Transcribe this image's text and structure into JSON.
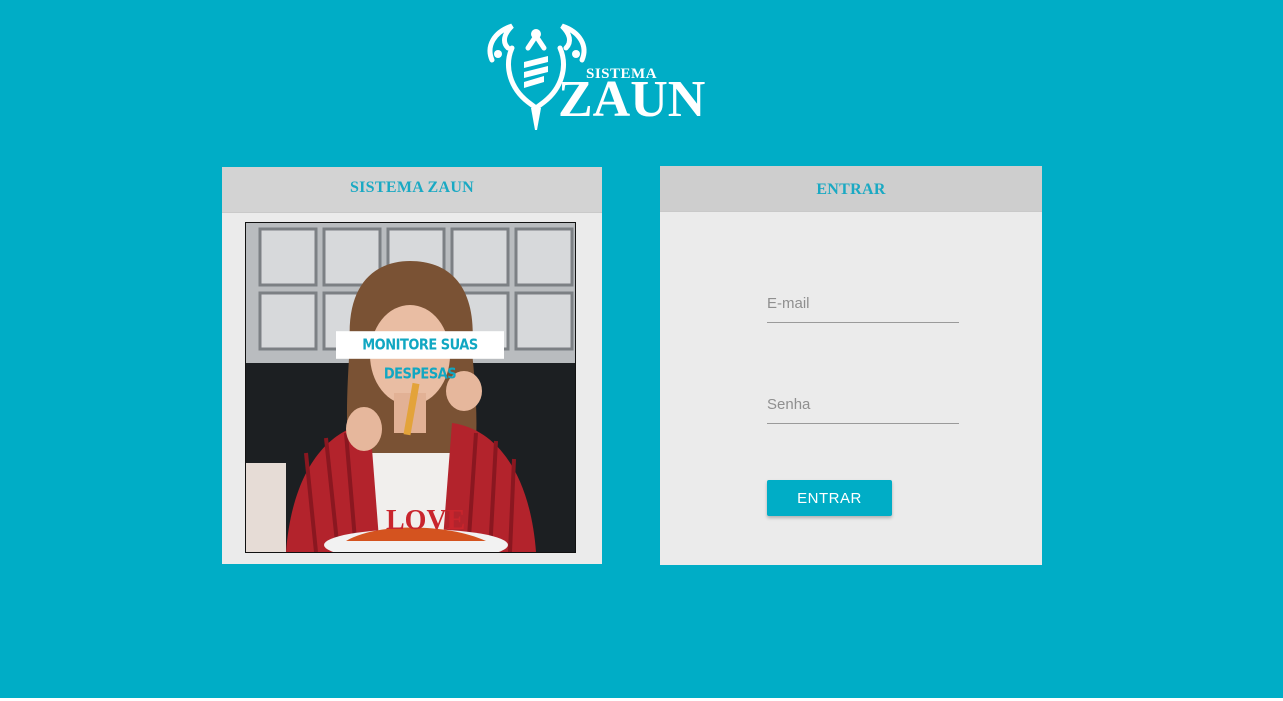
{
  "logo": {
    "small_text": "SISTEMA",
    "big_text": "ZAUN",
    "icon": "zaun-emblem-icon"
  },
  "left_panel": {
    "title": "SISTEMA ZAUN",
    "image_caption": "MONITORE SUAS DESPESAS",
    "image_icon": "photo-woman-eating-fries"
  },
  "right_panel": {
    "title": "ENTRAR",
    "email_placeholder": "E-mail",
    "email_value": "",
    "password_placeholder": "Senha",
    "password_value": "",
    "submit_label": "ENTRAR"
  },
  "colors": {
    "background": "#00adc6",
    "panel_body": "#ebebeb",
    "panel_header": "#d3d3d3",
    "accent": "#1aa9c3",
    "button": "#00adc6"
  }
}
